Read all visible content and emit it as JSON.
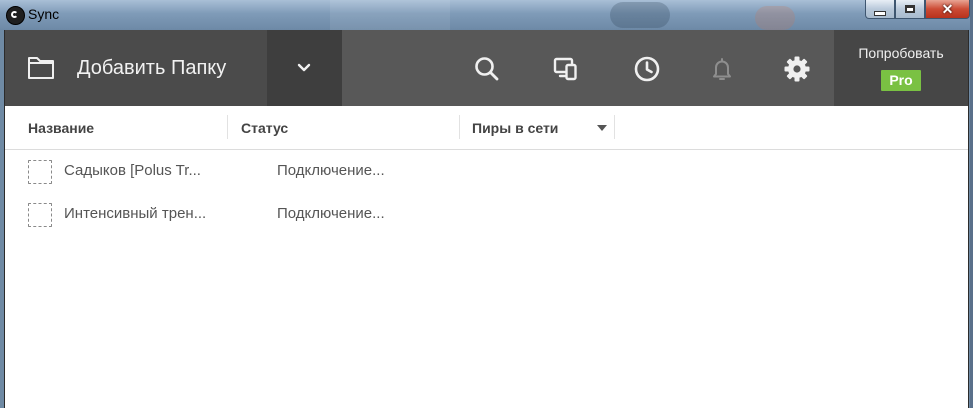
{
  "window": {
    "title": "Sync",
    "controls": [
      "minimize",
      "maximize",
      "close"
    ]
  },
  "toolbar": {
    "add_folder_label": "Добавить Папку",
    "icons": [
      "folder-icon",
      "chevron-down-icon",
      "search-icon",
      "devices-icon",
      "history-clock-icon",
      "bell-icon",
      "gear-icon"
    ],
    "try_label": "Попробовать",
    "pro_badge": "Pro",
    "colors": {
      "toolbar_bg": "#585858",
      "pro_green": "#7ac143"
    }
  },
  "table": {
    "columns": [
      {
        "label": "Название"
      },
      {
        "label": "Статус"
      },
      {
        "label": "Пиры в сети"
      }
    ],
    "rows": [
      {
        "name": "Садыков [Polus Tr...",
        "status": "Подключение..."
      },
      {
        "name": "Интенсивный трен...",
        "status": "Подключение..."
      }
    ]
  }
}
